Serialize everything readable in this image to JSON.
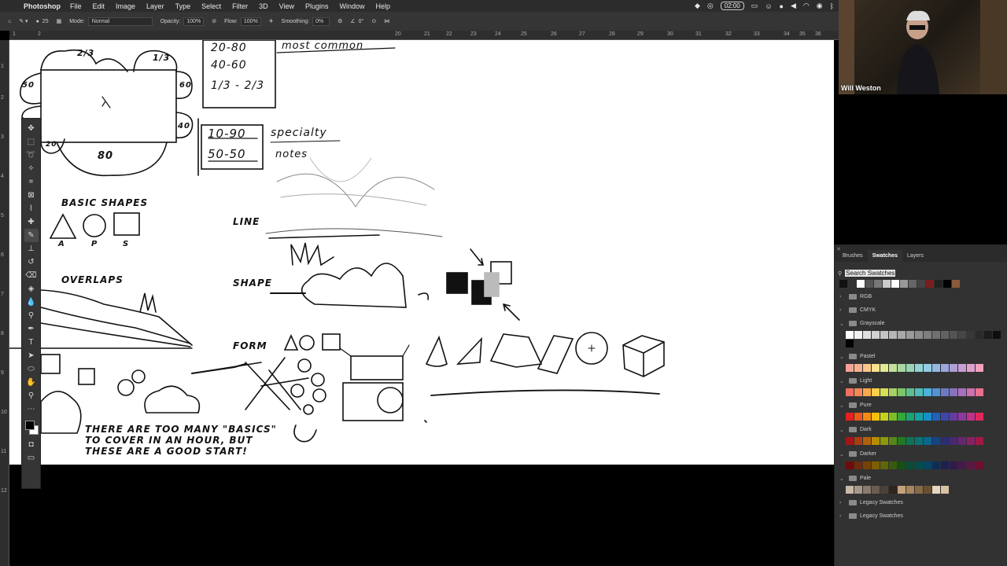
{
  "menubar": {
    "app": "Photoshop",
    "items": [
      "File",
      "Edit",
      "Image",
      "Layer",
      "Type",
      "Select",
      "Filter",
      "3D",
      "View",
      "Plugins",
      "Window",
      "Help"
    ],
    "clock": "02:00"
  },
  "options": {
    "brush_size": "25",
    "mode_label": "Mode:",
    "mode_value": "Normal",
    "opacity_label": "Opacity:",
    "opacity_value": "100%",
    "flow_label": "Flow:",
    "flow_value": "100%",
    "smoothing_label": "Smoothing:",
    "smoothing_value": "0%",
    "angle_value": "0°"
  },
  "ruler": {
    "top": [
      "1",
      "2",
      "20",
      "21",
      "22",
      "23",
      "24",
      "25",
      "26",
      "27",
      "28",
      "29",
      "30",
      "31",
      "32",
      "33",
      "34",
      "35",
      "36"
    ],
    "left": [
      "1",
      "2",
      "3",
      "4",
      "5",
      "6",
      "7",
      "8",
      "9",
      "10",
      "11",
      "12"
    ]
  },
  "canvas": {
    "basic_shapes": "BASIC SHAPES",
    "shape_letters": [
      "A",
      "P",
      "S"
    ],
    "overlaps": "OVERLAPS",
    "line": "LINE",
    "shape": "SHAPE",
    "form": "FORM",
    "ratio1": [
      "20-80",
      "40-60",
      "1/3 - 2/3"
    ],
    "ratio2": [
      "10-90",
      "50-50"
    ],
    "most_common": "most common",
    "specialty": "specialty",
    "notes": "notes",
    "fraction_top": "2/3",
    "fraction_right": "1/3",
    "n50": "50",
    "n60": "60",
    "n40": "40",
    "n80": "80",
    "n20": "20",
    "footer": [
      "THERE ARE TOO MANY \"BASICS\"",
      "TO COVER IN AN HOUR, BUT",
      "THESE ARE A GOOD START!"
    ]
  },
  "webcam": {
    "name": "Will Weston"
  },
  "swatches": {
    "tabs": [
      "Brushes",
      "Swatches",
      "Layers"
    ],
    "active_tab": "Swatches",
    "search_placeholder": "Search Swatches",
    "recent": [
      "#111111",
      "#333333",
      "#ffffff",
      "#555555",
      "#777777",
      "#cccccc",
      "#ffffff",
      "#999999",
      "#666666",
      "#444444",
      "#7a1e1e",
      "#222222",
      "#000000",
      "#8a5a3a"
    ],
    "groups": [
      {
        "name": "RGB",
        "open": false,
        "colors": []
      },
      {
        "name": "CMYK",
        "open": false,
        "colors": []
      },
      {
        "name": "Grayscale",
        "open": true,
        "colors": [
          "#ffffff",
          "#f0f0f0",
          "#e0e0e0",
          "#d2d2d2",
          "#c4c4c4",
          "#b6b6b6",
          "#a8a8a8",
          "#9a9a9a",
          "#8c8c8c",
          "#7e7e7e",
          "#707070",
          "#626262",
          "#545454",
          "#464646",
          "#383838",
          "#2a2a2a",
          "#1c1c1c",
          "#0e0e0e",
          "#000000"
        ]
      },
      {
        "name": "Pastel",
        "open": true,
        "colors": [
          "#f4a19a",
          "#f6b08d",
          "#fac58c",
          "#fde18d",
          "#e4ea92",
          "#c4e09a",
          "#a7d8a0",
          "#97d4b7",
          "#93d3d3",
          "#92cce6",
          "#93b8e4",
          "#9ea5dc",
          "#b09ed6",
          "#c79ed6",
          "#e0a0cf",
          "#f2a2b9"
        ]
      },
      {
        "name": "Light",
        "open": true,
        "colors": [
          "#ef6f61",
          "#f28a56",
          "#f7a84f",
          "#fbd04a",
          "#d6df55",
          "#a8d062",
          "#7dc46b",
          "#5fbe91",
          "#4fbdbd",
          "#4eb1d8",
          "#5194d3",
          "#6a7cc6",
          "#8772bd",
          "#a971bb",
          "#cf6fae",
          "#e9708f"
        ]
      },
      {
        "name": "Pure",
        "open": true,
        "colors": [
          "#e52222",
          "#ea5a1c",
          "#f28a14",
          "#f8c20c",
          "#c6d219",
          "#7cbd28",
          "#34a93a",
          "#1ba274",
          "#12a2a2",
          "#1690c8",
          "#1f63b8",
          "#3e46a8",
          "#653c9e",
          "#8e3a9c",
          "#c1308c",
          "#e0285e"
        ]
      },
      {
        "name": "Dark",
        "open": true,
        "colors": [
          "#a31616",
          "#a83e10",
          "#b0620a",
          "#b68c04",
          "#8f970d",
          "#578617",
          "#237824",
          "#0f7352",
          "#097373",
          "#0b668f",
          "#134484",
          "#2b2f78",
          "#482970",
          "#65276f",
          "#8a2063",
          "#a01942"
        ]
      },
      {
        "name": "Darker",
        "open": true,
        "colors": [
          "#6e0d0d",
          "#722908",
          "#784204",
          "#7c5f01",
          "#616607",
          "#3a5a0d",
          "#174f16",
          "#094d36",
          "#044d4d",
          "#054561",
          "#0b2e59",
          "#1d2051",
          "#301b4b",
          "#441a4b",
          "#5e1543",
          "#6c102c"
        ]
      },
      {
        "name": "Pale",
        "open": true,
        "colors": [
          "#c8b8a6",
          "#a9988a",
          "#8a7a6e",
          "#6b5d52",
          "#4c4038",
          "#2d2520",
          "#c4a27c",
          "#a6855f",
          "#886a46",
          "#6a5031",
          "#e6d6c0",
          "#d8c2a3"
        ]
      },
      {
        "name": "Legacy Swatches",
        "open": false,
        "colors": []
      },
      {
        "name": "Legacy Swatches",
        "open": false,
        "colors": []
      }
    ]
  }
}
